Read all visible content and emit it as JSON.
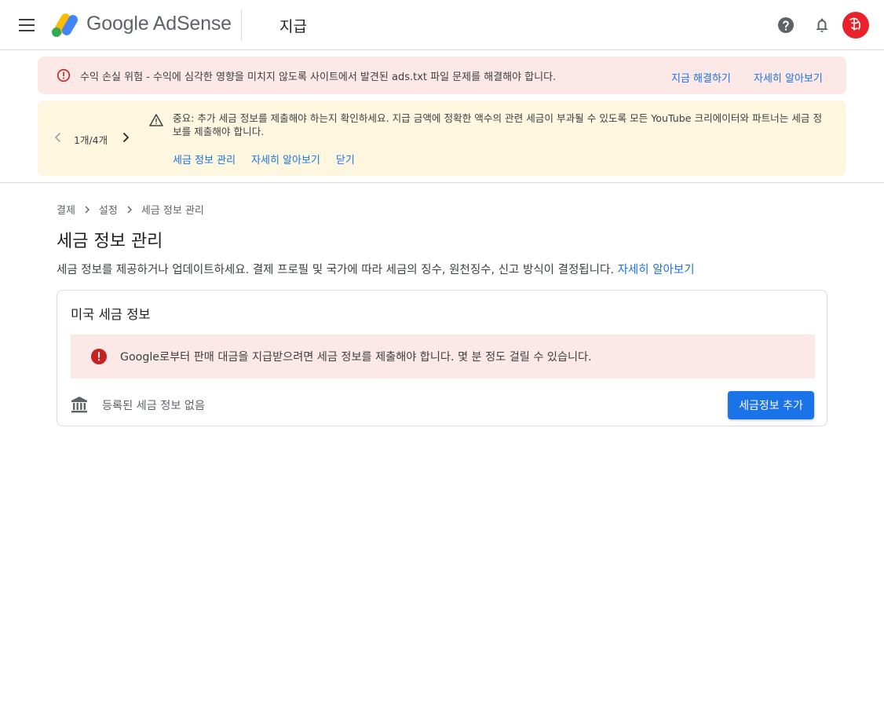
{
  "header": {
    "product_name": "Google AdSense",
    "page_name": "지급"
  },
  "alerts": {
    "revenue_risk": {
      "message": "수익 손실 위험 - 수익에 심각한 영향을 미치지 않도록 사이트에서 발견된 ads.txt 파일 문제를 해결해야 합니다.",
      "fix_label": "지금 해결하기",
      "learn_more_label": "자세히 알아보기"
    },
    "tax_notice": {
      "pager": "1개/4개",
      "message": "중요: 추가 세금 정보를 제출해야 하는지 확인하세요. 지급 금액에 정확한 액수의 관련 세금이 부과될 수 있도록 모든 YouTube 크리에이터와 파트너는 세금 정보를 제출해야 합니다.",
      "links": [
        "세금 정보 관리",
        "자세히 알아보기",
        "닫기"
      ]
    }
  },
  "breadcrumb": [
    "결제",
    "설정",
    "세금 정보 관리"
  ],
  "page": {
    "title": "세금 정보 관리",
    "description": "세금 정보를 제공하거나 업데이트하세요. 결제 프로필 및 국가에 따라 세금의 징수, 원천징수, 신고 방식이 결정됩니다.",
    "description_link": "자세히 알아보기"
  },
  "us_tax_card": {
    "title": "미국 세금 정보",
    "alert": "Google로부터 판매 대금을 지급받으려면 세금 정보를 제출해야 합니다. 몇 분 정도 걸릴 수 있습니다.",
    "empty_text": "등록된 세금 정보 없음",
    "add_button": "세금정보 추가"
  },
  "colors": {
    "accent": "#1a73e8",
    "error": "#c5221f",
    "error_bg": "#fce8e6",
    "warning_bg": "#fef7e0",
    "avatar_bg": "#e8212b"
  },
  "icons": [
    "menu-icon",
    "adsense-logo",
    "help-icon",
    "bell-icon",
    "avatar",
    "error-outline-icon",
    "chevron-left-icon",
    "chevron-right-icon",
    "warning-icon",
    "error-filled-icon",
    "bank-icon"
  ]
}
